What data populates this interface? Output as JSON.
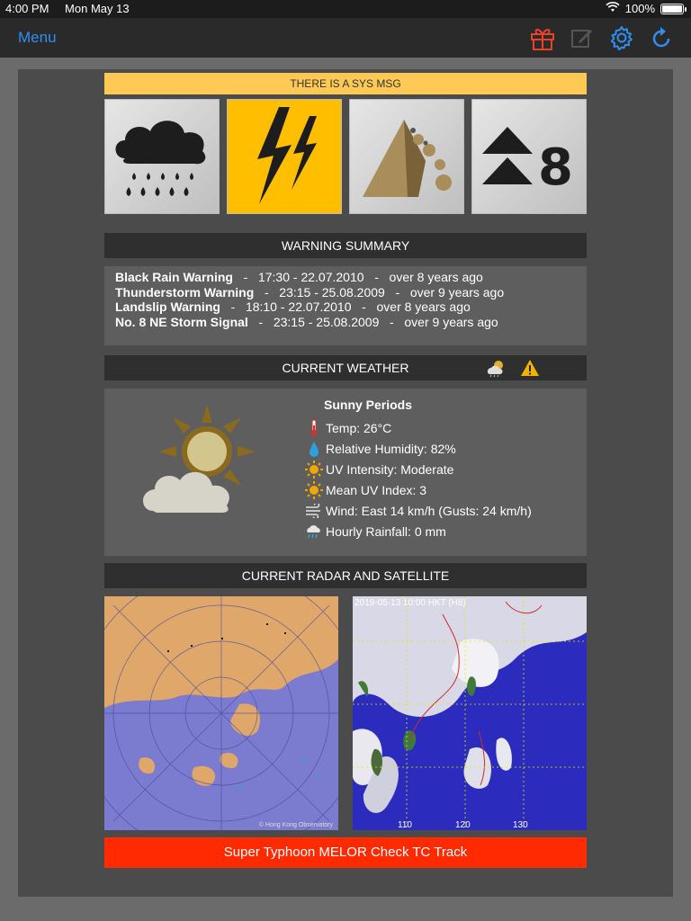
{
  "status_bar": {
    "time": "4:00 PM",
    "date": "Mon May 13",
    "battery": "100%"
  },
  "nav": {
    "menu_label": "Menu",
    "tool_icons": [
      "gift-icon",
      "compose-icon",
      "gear-icon",
      "refresh-icon"
    ],
    "colors": {
      "accent": "#2f8ff0",
      "gift": "#e8432a"
    }
  },
  "sys_msg": "THERE IS A SYS MSG",
  "warning_icons": [
    "black-rain-icon",
    "thunderstorm-icon",
    "landslip-icon",
    "storm-signal-8-icon"
  ],
  "storm_signal_number": "8",
  "warning_summary": {
    "title": "WARNING SUMMARY",
    "items": [
      {
        "name": "Black Rain Warning",
        "sep1": "-",
        "time": "17:30 - 22.07.2010",
        "sep2": "-",
        "age": "over 8 years ago"
      },
      {
        "name": "Thunderstorm Warning",
        "sep1": "-",
        "time": "23:15 - 25.08.2009",
        "sep2": "-",
        "age": "over 9 years ago"
      },
      {
        "name": "Landslip Warning",
        "sep1": "-",
        "time": "18:10 - 22.07.2010",
        "sep2": "-",
        "age": "over 8 years ago"
      },
      {
        "name": "No. 8 NE Storm Signal",
        "sep1": "-",
        "time": "23:15 - 25.08.2009",
        "sep2": "-",
        "age": "over 9 years ago"
      }
    ]
  },
  "current_weather": {
    "title": "CURRENT WEATHER",
    "description": "Sunny Periods",
    "rows": [
      {
        "icon": "thermometer-icon",
        "text": "Temp: 26°C"
      },
      {
        "icon": "humidity-drop-icon",
        "text": "Relative Humidity: 82%"
      },
      {
        "icon": "uv-sun-icon",
        "text": "UV Intensity: Moderate"
      },
      {
        "icon": "uv-sun-icon",
        "text": "Mean UV Index: 3"
      },
      {
        "icon": "wind-icon",
        "text": "Wind: East 14 km/h (Gusts: 24 km/h)"
      },
      {
        "icon": "rain-cloud-icon",
        "text": "Hourly Rainfall: 0 mm"
      }
    ]
  },
  "radar_satellite": {
    "title": "CURRENT RADAR AND SATELLITE",
    "radar_credit": "© Hong Kong Observatory",
    "satellite_timestamp": "2019-05-13 10:00 HKT (H8)",
    "satellite_lon_labels": [
      "110",
      "120",
      "130"
    ]
  },
  "typhoon_banner": "Super Typhoon MELOR Check TC Track"
}
